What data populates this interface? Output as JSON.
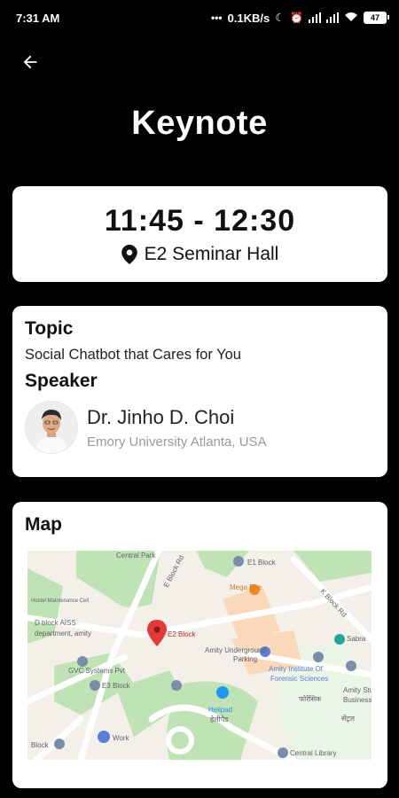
{
  "status": {
    "time": "7:31 AM",
    "speed": "0.1KB/s",
    "battery": "47"
  },
  "page": {
    "title": "Keynote"
  },
  "session": {
    "time": "11:45 - 12:30",
    "venue": "E2 Seminar Hall"
  },
  "details": {
    "topic_label": "Topic",
    "topic": "Social Chatbot that Cares for You",
    "speaker_label": "Speaker",
    "speaker_name": "Dr. Jinho D. Choi",
    "speaker_affiliation": "Emory University Atlanta, USA"
  },
  "map": {
    "title": "Map",
    "labels": {
      "central_park": "Central Park",
      "e_block_rd": "E Block Rd",
      "e1_block": "E1 Block",
      "mega_bite": "Mega Bite",
      "k_block_rd": "K Block Rd",
      "hostel": "Hostel Maintenance Cell",
      "d_block": "D block AISS",
      "d_block_2": "department, amity",
      "e2_block": "E2 Block",
      "sabra": "Sabra",
      "underground": "Amity Underground",
      "parking": "Parking",
      "gvc": "GVC Systems Pvt",
      "forensic1": "Amity Institute Of",
      "forensic2": "Forensic Sciences",
      "forensic3": "फोरेंसिक",
      "e3_block": "E3 Block",
      "amity_study1": "Amity Stu",
      "amity_study2": "Business",
      "helipad": "Helipad",
      "helipad_hi": "हेलीपैड",
      "work": "Work",
      "block": "Block",
      "central_library": "Central Library",
      "library_hi": "सेंट्रल"
    },
    "colors": {
      "green": "#bfe3b4",
      "road": "#ffffff",
      "pin": "#e53935",
      "poi_blue": "#5a7fd8",
      "poi_orange": "#f08a24"
    }
  }
}
